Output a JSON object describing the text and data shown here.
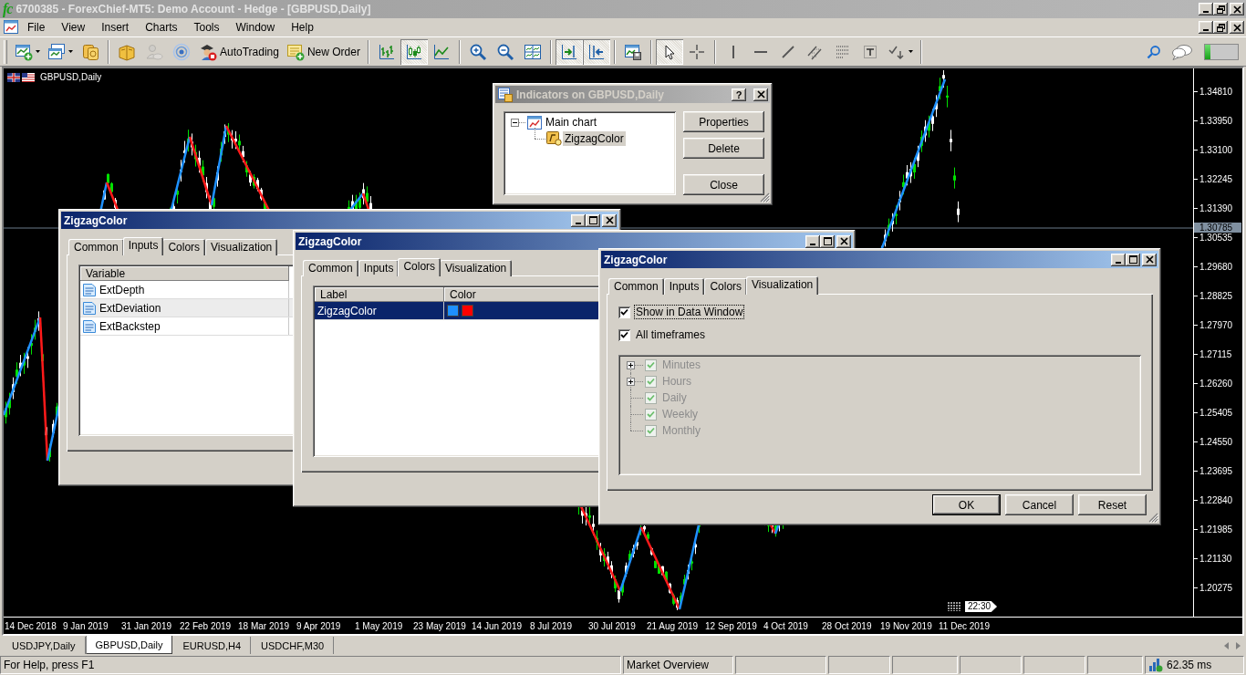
{
  "window": {
    "logo": "fc",
    "title": "6700385 - ForexChief-MT5: Demo Account - Hedge - [GBPUSD,Daily]",
    "active": false
  },
  "menu": [
    "File",
    "View",
    "Insert",
    "Charts",
    "Tools",
    "Window",
    "Help"
  ],
  "toolbar": {
    "groups": [
      {
        "items": [
          {
            "kind": "split",
            "pressed": false,
            "disabled": false
          },
          {
            "kind": "split",
            "pressed": false,
            "disabled": false
          },
          {
            "kind": "icon",
            "pressed": false,
            "disabled": false
          }
        ]
      },
      {
        "items": [
          {
            "kind": "icon",
            "pressed": false,
            "disabled": false
          },
          {
            "kind": "icon",
            "pressed": false,
            "disabled": true
          },
          {
            "kind": "icon",
            "pressed": false,
            "disabled": false
          },
          {
            "kind": "labeled",
            "label": "AutoTrading",
            "pressed": false,
            "disabled": false
          },
          {
            "kind": "labeled",
            "label": "New Order",
            "pressed": false,
            "disabled": false
          }
        ]
      },
      {
        "items": [
          {
            "kind": "icon",
            "pressed": false,
            "disabled": false
          },
          {
            "kind": "icon",
            "pressed": true,
            "disabled": false
          },
          {
            "kind": "icon",
            "pressed": false,
            "disabled": false
          }
        ]
      },
      {
        "items": [
          {
            "kind": "icon",
            "pressed": false,
            "disabled": false
          },
          {
            "kind": "icon",
            "pressed": false,
            "disabled": false
          },
          {
            "kind": "icon",
            "pressed": false,
            "disabled": false
          }
        ]
      },
      {
        "items": [
          {
            "kind": "icon",
            "pressed": true,
            "disabled": false
          },
          {
            "kind": "icon",
            "pressed": true,
            "disabled": false
          }
        ]
      },
      {
        "items": [
          {
            "kind": "icon",
            "pressed": false,
            "disabled": false
          }
        ]
      },
      {
        "items": [
          {
            "kind": "icon",
            "pressed": true,
            "disabled": false
          },
          {
            "kind": "icon",
            "pressed": false,
            "disabled": false
          }
        ]
      },
      {
        "items": [
          {
            "kind": "icon",
            "pressed": false,
            "disabled": false
          },
          {
            "kind": "icon",
            "pressed": false,
            "disabled": false
          },
          {
            "kind": "icon",
            "pressed": false,
            "disabled": false
          },
          {
            "kind": "icon",
            "pressed": false,
            "disabled": false
          },
          {
            "kind": "icon",
            "pressed": false,
            "disabled": false
          },
          {
            "kind": "icon",
            "pressed": false,
            "disabled": false
          },
          {
            "kind": "split",
            "pressed": false,
            "disabled": false
          }
        ]
      }
    ],
    "meter": {
      "level": 0.18
    }
  },
  "chart": {
    "symbol": "GBPUSD,Daily",
    "price_labels": [
      "1.34810",
      "1.33950",
      "1.33100",
      "1.32245",
      "1.31390",
      "1.30535",
      "1.29680",
      "1.28825",
      "1.27970",
      "1.27115",
      "1.26260",
      "1.25405",
      "1.24550",
      "1.23695",
      "1.22840",
      "1.21985",
      "1.21130",
      "1.20275"
    ],
    "current_price": "1.30785",
    "time_labels": [
      "14 Dec 2018",
      "9 Jan 2019",
      "31 Jan 2019",
      "22 Feb 2019",
      "18 Mar 2019",
      "9 Apr 2019",
      "1 May 2019",
      "23 May 2019",
      "14 Jun 2019",
      "8 Jul 2019",
      "30 Jul 2019",
      "21 Aug 2019",
      "12 Sep 2019",
      "4 Oct 2019",
      "28 Oct 2019",
      "19 Nov 2019",
      "11 Dec 2019"
    ],
    "time_marker": "22:30"
  },
  "indicators_dialog": {
    "title": "Indicators on GBPUSD,Daily",
    "active": false,
    "help": "?",
    "tree": [
      {
        "label": "Main chart",
        "expanded": true,
        "selected": false,
        "children": [
          {
            "label": "ZigzagColor",
            "selected": true
          }
        ]
      }
    ],
    "buttons": [
      "Properties",
      "Delete",
      "Close"
    ]
  },
  "property_dialogs": [
    {
      "title": "ZigzagColor",
      "active": true,
      "tabs": [
        {
          "label": "Common",
          "selected": false
        },
        {
          "label": "Inputs",
          "selected": true
        },
        {
          "label": "Colors",
          "selected": false
        },
        {
          "label": "Visualization",
          "selected": false
        }
      ],
      "page": {
        "kind": "inputs",
        "columns": [
          "Variable"
        ],
        "rows": [
          {
            "name": "ExtDepth",
            "selected": false
          },
          {
            "name": "ExtDeviation",
            "selected": true
          },
          {
            "name": "ExtBackstep",
            "selected": false
          }
        ]
      }
    },
    {
      "title": "ZigzagColor",
      "active": true,
      "tabs": [
        {
          "label": "Common",
          "selected": false
        },
        {
          "label": "Inputs",
          "selected": false
        },
        {
          "label": "Colors",
          "selected": true
        },
        {
          "label": "Visualization",
          "selected": false
        }
      ],
      "page": {
        "kind": "colors",
        "columns": [
          "Label",
          "Color"
        ],
        "rows": [
          {
            "label": "ZigzagColor",
            "selected": true,
            "colors": [
              {
                "color": "#1e90ff"
              },
              {
                "color": "#ff0000"
              }
            ]
          }
        ]
      }
    },
    {
      "title": "ZigzagColor",
      "active": true,
      "tabs": [
        {
          "label": "Common",
          "selected": false
        },
        {
          "label": "Inputs",
          "selected": false
        },
        {
          "label": "Colors",
          "selected": false
        },
        {
          "label": "Visualization",
          "selected": true
        }
      ],
      "page": {
        "kind": "visualization",
        "options": [
          {
            "label": "Show in Data Window",
            "checked": true,
            "focused": true
          },
          {
            "label": "All timeframes",
            "checked": true,
            "focused": false
          }
        ],
        "timeframes": {
          "disabled": true,
          "items": [
            {
              "kind": "group",
              "label": "Minutes",
              "checked": true,
              "expanded": false
            },
            {
              "kind": "group",
              "label": "Hours",
              "checked": true,
              "expanded": false
            },
            {
              "kind": "leaf",
              "label": "Daily",
              "checked": true
            },
            {
              "kind": "leaf",
              "label": "Weekly",
              "checked": true
            },
            {
              "kind": "leaf",
              "label": "Monthly",
              "checked": true
            }
          ]
        }
      },
      "buttons": [
        {
          "label": "OK",
          "default": true
        },
        {
          "label": "Cancel",
          "default": false
        },
        {
          "label": "Reset",
          "default": false
        }
      ]
    }
  ],
  "chart_tabs": [
    {
      "label": "USDJPY,Daily",
      "selected": false
    },
    {
      "label": "GBPUSD,Daily",
      "selected": true
    },
    {
      "label": "EURUSD,H4",
      "selected": false
    },
    {
      "label": "USDCHF,M30",
      "selected": false
    }
  ],
  "status_bar": {
    "help": "For Help, press F1",
    "market": "Market Overview",
    "ping": "62.35 ms"
  }
}
